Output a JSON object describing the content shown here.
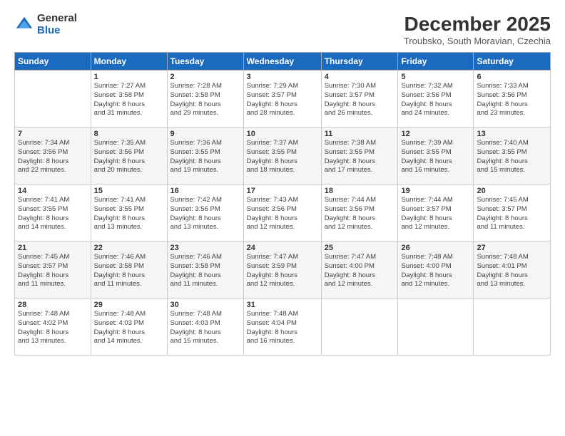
{
  "logo": {
    "general": "General",
    "blue": "Blue"
  },
  "header": {
    "month_title": "December 2025",
    "subtitle": "Troubsko, South Moravian, Czechia"
  },
  "weekdays": [
    "Sunday",
    "Monday",
    "Tuesday",
    "Wednesday",
    "Thursday",
    "Friday",
    "Saturday"
  ],
  "weeks": [
    [
      {
        "day": "",
        "info": ""
      },
      {
        "day": "1",
        "info": "Sunrise: 7:27 AM\nSunset: 3:58 PM\nDaylight: 8 hours\nand 31 minutes."
      },
      {
        "day": "2",
        "info": "Sunrise: 7:28 AM\nSunset: 3:58 PM\nDaylight: 8 hours\nand 29 minutes."
      },
      {
        "day": "3",
        "info": "Sunrise: 7:29 AM\nSunset: 3:57 PM\nDaylight: 8 hours\nand 28 minutes."
      },
      {
        "day": "4",
        "info": "Sunrise: 7:30 AM\nSunset: 3:57 PM\nDaylight: 8 hours\nand 26 minutes."
      },
      {
        "day": "5",
        "info": "Sunrise: 7:32 AM\nSunset: 3:56 PM\nDaylight: 8 hours\nand 24 minutes."
      },
      {
        "day": "6",
        "info": "Sunrise: 7:33 AM\nSunset: 3:56 PM\nDaylight: 8 hours\nand 23 minutes."
      }
    ],
    [
      {
        "day": "7",
        "info": "Sunrise: 7:34 AM\nSunset: 3:56 PM\nDaylight: 8 hours\nand 22 minutes."
      },
      {
        "day": "8",
        "info": "Sunrise: 7:35 AM\nSunset: 3:56 PM\nDaylight: 8 hours\nand 20 minutes."
      },
      {
        "day": "9",
        "info": "Sunrise: 7:36 AM\nSunset: 3:55 PM\nDaylight: 8 hours\nand 19 minutes."
      },
      {
        "day": "10",
        "info": "Sunrise: 7:37 AM\nSunset: 3:55 PM\nDaylight: 8 hours\nand 18 minutes."
      },
      {
        "day": "11",
        "info": "Sunrise: 7:38 AM\nSunset: 3:55 PM\nDaylight: 8 hours\nand 17 minutes."
      },
      {
        "day": "12",
        "info": "Sunrise: 7:39 AM\nSunset: 3:55 PM\nDaylight: 8 hours\nand 16 minutes."
      },
      {
        "day": "13",
        "info": "Sunrise: 7:40 AM\nSunset: 3:55 PM\nDaylight: 8 hours\nand 15 minutes."
      }
    ],
    [
      {
        "day": "14",
        "info": "Sunrise: 7:41 AM\nSunset: 3:55 PM\nDaylight: 8 hours\nand 14 minutes."
      },
      {
        "day": "15",
        "info": "Sunrise: 7:41 AM\nSunset: 3:55 PM\nDaylight: 8 hours\nand 13 minutes."
      },
      {
        "day": "16",
        "info": "Sunrise: 7:42 AM\nSunset: 3:56 PM\nDaylight: 8 hours\nand 13 minutes."
      },
      {
        "day": "17",
        "info": "Sunrise: 7:43 AM\nSunset: 3:56 PM\nDaylight: 8 hours\nand 12 minutes."
      },
      {
        "day": "18",
        "info": "Sunrise: 7:44 AM\nSunset: 3:56 PM\nDaylight: 8 hours\nand 12 minutes."
      },
      {
        "day": "19",
        "info": "Sunrise: 7:44 AM\nSunset: 3:57 PM\nDaylight: 8 hours\nand 12 minutes."
      },
      {
        "day": "20",
        "info": "Sunrise: 7:45 AM\nSunset: 3:57 PM\nDaylight: 8 hours\nand 11 minutes."
      }
    ],
    [
      {
        "day": "21",
        "info": "Sunrise: 7:45 AM\nSunset: 3:57 PM\nDaylight: 8 hours\nand 11 minutes."
      },
      {
        "day": "22",
        "info": "Sunrise: 7:46 AM\nSunset: 3:58 PM\nDaylight: 8 hours\nand 11 minutes."
      },
      {
        "day": "23",
        "info": "Sunrise: 7:46 AM\nSunset: 3:58 PM\nDaylight: 8 hours\nand 11 minutes."
      },
      {
        "day": "24",
        "info": "Sunrise: 7:47 AM\nSunset: 3:59 PM\nDaylight: 8 hours\nand 12 minutes."
      },
      {
        "day": "25",
        "info": "Sunrise: 7:47 AM\nSunset: 4:00 PM\nDaylight: 8 hours\nand 12 minutes."
      },
      {
        "day": "26",
        "info": "Sunrise: 7:48 AM\nSunset: 4:00 PM\nDaylight: 8 hours\nand 12 minutes."
      },
      {
        "day": "27",
        "info": "Sunrise: 7:48 AM\nSunset: 4:01 PM\nDaylight: 8 hours\nand 13 minutes."
      }
    ],
    [
      {
        "day": "28",
        "info": "Sunrise: 7:48 AM\nSunset: 4:02 PM\nDaylight: 8 hours\nand 13 minutes."
      },
      {
        "day": "29",
        "info": "Sunrise: 7:48 AM\nSunset: 4:03 PM\nDaylight: 8 hours\nand 14 minutes."
      },
      {
        "day": "30",
        "info": "Sunrise: 7:48 AM\nSunset: 4:03 PM\nDaylight: 8 hours\nand 15 minutes."
      },
      {
        "day": "31",
        "info": "Sunrise: 7:48 AM\nSunset: 4:04 PM\nDaylight: 8 hours\nand 16 minutes."
      },
      {
        "day": "",
        "info": ""
      },
      {
        "day": "",
        "info": ""
      },
      {
        "day": "",
        "info": ""
      }
    ]
  ]
}
